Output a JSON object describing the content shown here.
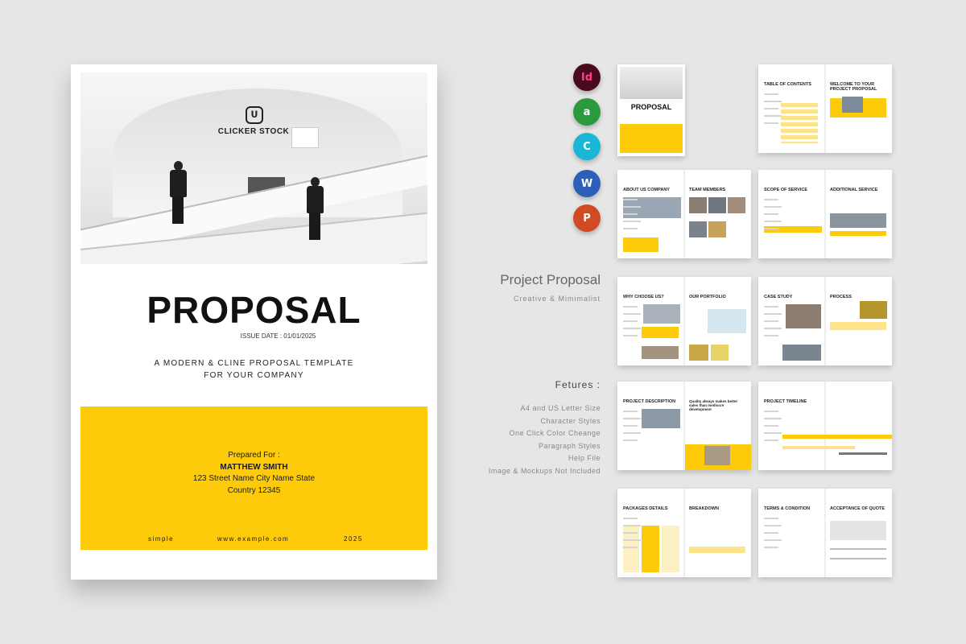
{
  "cover": {
    "brand": "CLICKER STOCK",
    "logo_mark": "ᑌ",
    "title": "PROPOSAL",
    "issue_date": "ISSUE DATE : 01/01/2025",
    "tagline_1": "A MODERN & CLINE PROPOSAL TEMPLATE",
    "tagline_2": "FOR YOUR COMPANY",
    "prepared_for_label": "Prepared For :",
    "client_name": "MATTHEW SMITH",
    "address_1": "123 Street Name City Name State",
    "address_2": "Country 12345",
    "footer_left": "simple",
    "footer_center": "www.example.com",
    "footer_right": "2025"
  },
  "apps": [
    {
      "label": "Id",
      "icon": "indesign-icon",
      "color": "#4a0a1e",
      "text_color": "#ff3d8b"
    },
    {
      "label": "a",
      "icon": "affinity-icon",
      "color": "#2b9a3f",
      "text_color": "#ffffff"
    },
    {
      "label": "C",
      "icon": "canva-icon",
      "color": "#19b6d6",
      "text_color": "#ffffff"
    },
    {
      "label": "W",
      "icon": "word-icon",
      "color": "#2b5fb8",
      "text_color": "#ffffff"
    },
    {
      "label": "P",
      "icon": "powerpoint-icon",
      "color": "#d04a23",
      "text_color": "#ffffff"
    }
  ],
  "product": {
    "title": "Project Proposal",
    "subtitle": "Creative & Mimimalist"
  },
  "features": {
    "title": "Fetures :",
    "items": [
      "A4 and US Letter Size",
      "Character Styles",
      "One Click Color Cheange",
      "Paragraph Styles",
      "Help File",
      "Image & Mockups Not Included"
    ]
  },
  "thumbs": {
    "cover_title": "PROPOSAL",
    "spreads": [
      {
        "left": "TABLE OF CONTENTS",
        "right": "WELCOME TO YOUR PROJECT PROPOSAL"
      },
      {
        "left": "ABOUT US COMPANY",
        "right": "TEAM MEMBERS"
      },
      {
        "left": "SCOPE OF SERVICE",
        "right": "ADDITIONAL SERVICE"
      },
      {
        "left": "WHY CHOOSE US?",
        "right": "OUR PORTFOLIO"
      },
      {
        "left": "CASE STUDY",
        "right": "PROCESS"
      },
      {
        "left": "PROJECT DESCRIPTION",
        "right": "Quality always makes better sales than mediocre development"
      },
      {
        "left": "PROJECT TIMELINE",
        "right": ""
      },
      {
        "left": "PACKAGES DETAILS",
        "right": "BREAKDOWN"
      },
      {
        "left": "TERMS & CONDITION",
        "right": "ACCEPTANCE OF QUOTE"
      }
    ]
  },
  "colors": {
    "accent": "#fecb0b",
    "background": "#e6e6e6"
  }
}
